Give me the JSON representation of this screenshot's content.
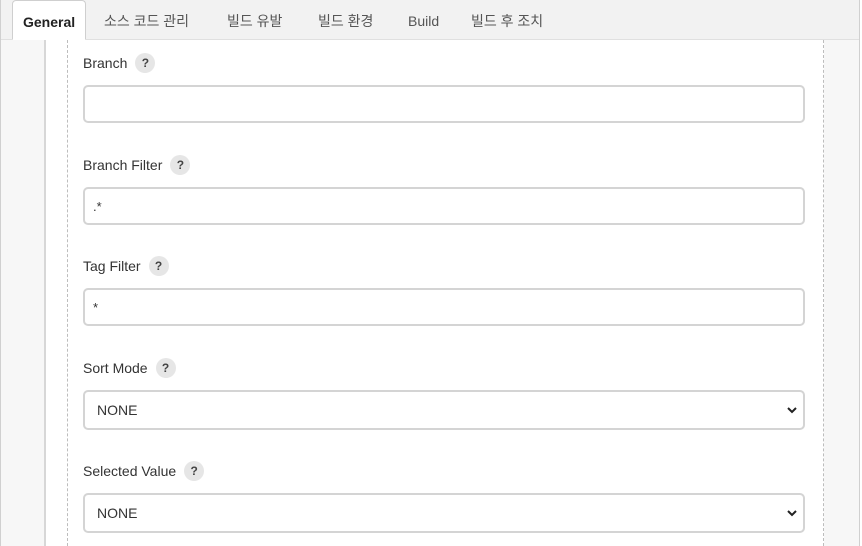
{
  "tabs": [
    {
      "label": "General",
      "active": true
    },
    {
      "label": "소스 코드 관리"
    },
    {
      "label": "빌드 유발"
    },
    {
      "label": "빌드 환경"
    },
    {
      "label": "Build"
    },
    {
      "label": "빌드 후 조치"
    }
  ],
  "help_glyph": "?",
  "fields": {
    "branch": {
      "label": "Branch",
      "value": ""
    },
    "branch_filter": {
      "label": "Branch Filter",
      "value": ".*"
    },
    "tag_filter": {
      "label": "Tag Filter",
      "value": "*"
    },
    "sort_mode": {
      "label": "Sort Mode",
      "value": "NONE"
    },
    "selected_value": {
      "label": "Selected Value",
      "value": "NONE"
    }
  }
}
